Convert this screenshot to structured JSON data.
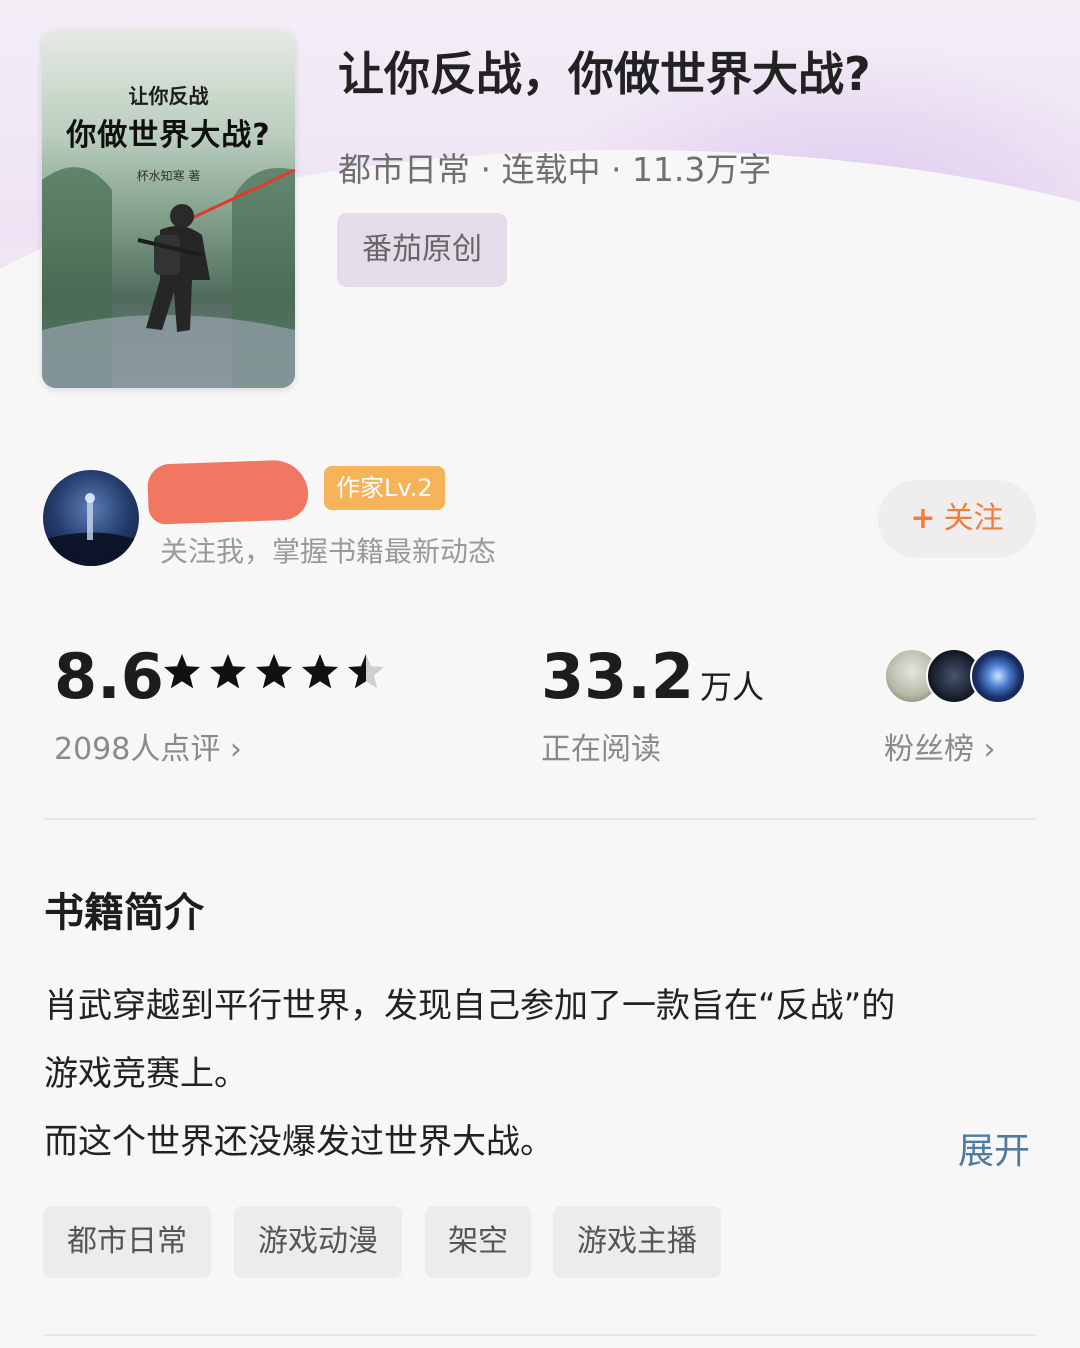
{
  "book": {
    "cover": {
      "subtitle": "让你反战",
      "title": "你做世界大战?",
      "author": "杯水知寒 著"
    },
    "title": "让你反战，你做世界大战?",
    "meta": "都市日常 · 连载中 · 11.3万字",
    "source_tag": "番茄原创"
  },
  "author": {
    "level_badge": "作家Lv.2",
    "hint": "关注我，掌握书籍最新动态",
    "follow_plus": "+",
    "follow_label": "关注"
  },
  "stats": {
    "rating": "8.6",
    "rating_stars": 4.5,
    "review_count": "2098人点评 ›",
    "readers_value": "33.2",
    "readers_unit": "万人",
    "readers_label": "正在阅读",
    "fans_label": "粉丝榜 ›"
  },
  "synopsis": {
    "heading": "书籍简介",
    "lines": [
      "肖武穿越到平行世界，发现自己参加了一款旨在“反战”的",
      "游戏竞赛上。",
      "而这个世界还没爆发过世界大战。"
    ],
    "expand": "展开"
  },
  "tags": [
    "都市日常",
    "游戏动漫",
    "架空",
    "游戏主播"
  ],
  "colors": {
    "accent_orange": "#f07d3c",
    "level_badge": "#f6b35a",
    "expand_link": "#4e7c9e"
  }
}
